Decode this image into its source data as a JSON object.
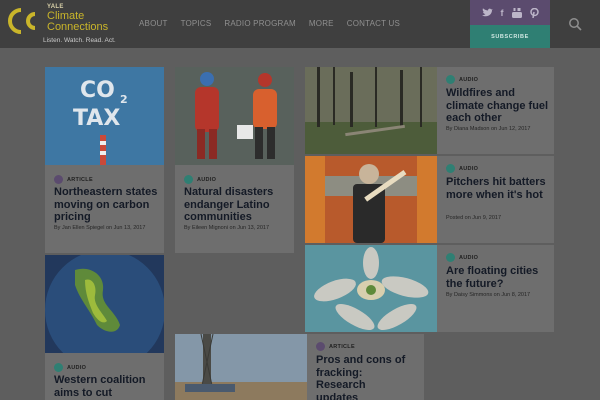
{
  "header": {
    "logo_small": "YALE",
    "logo_line1": "Climate",
    "logo_line2": "Connections",
    "tagline": "Listen. Watch. Read. Act.",
    "nav": [
      "ABOUT",
      "TOPICS",
      "RADIO PROGRAM",
      "MORE",
      "CONTACT US"
    ],
    "social": [
      "twitter-icon",
      "facebook-icon",
      "youtube-icon",
      "pinterest-icon"
    ],
    "subscribe_label": "SUBSCRIBE",
    "search_icon": "search-icon"
  },
  "colors": {
    "header_bg": "#3f3f3f",
    "brand_gold": "#c9b52a",
    "social_purple": "#5b4b6e",
    "subscribe_teal": "#2f7f73",
    "audio_badge": "#2f7f73",
    "article_badge": "#5b4b6e"
  },
  "cards": [
    {
      "type": "ARTICLE",
      "title": "Northeastern states moving on carbon pricing",
      "meta": "By Jan Ellen Spiegel on Jun 13, 2017",
      "image": "co2-tax-clouds"
    },
    {
      "type": "AUDIO",
      "title": "Natural disasters endanger Latino communities",
      "meta": "By Eileen Mignoni on Jun 13, 2017",
      "image": "rescue-workers"
    },
    {
      "type": "AUDIO",
      "title": "Wildfires and climate change fuel each other",
      "meta": "By Diana Madson on Jun 12, 2017",
      "image": "burned-forest"
    },
    {
      "type": "AUDIO",
      "title": "Pitchers hit batters more when it's hot",
      "meta": "Posted on Jun 9, 2017",
      "image": "man-with-bat"
    },
    {
      "type": "AUDIO",
      "title": "Are floating cities the future?",
      "meta": "By Daisy Simmons on Jun 8, 2017",
      "image": "floating-city"
    },
    {
      "type": "AUDIO",
      "title": "Western coalition aims to cut",
      "meta": "",
      "image": "globe-map"
    },
    {
      "type": "ARTICLE",
      "title": "Pros and cons of fracking: Research updates",
      "meta": "",
      "image": "drilling-rig"
    }
  ]
}
